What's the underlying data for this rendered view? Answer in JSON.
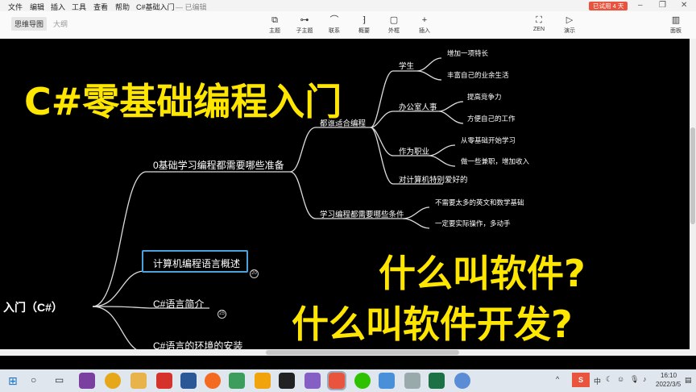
{
  "menubar": {
    "items": [
      "文件",
      "编辑",
      "插入",
      "工具",
      "查看",
      "帮助"
    ],
    "doc_title": "C#基础入门",
    "save_status": "— 已编辑",
    "trial_badge": "已试用 4 天"
  },
  "toolbar": {
    "view_tabs": [
      "思维导图",
      "大纲"
    ],
    "buttons": [
      "主题",
      "子主题",
      "联系",
      "概要",
      "外框",
      "插入"
    ],
    "right_buttons": [
      "ZEN",
      "演示",
      "面板"
    ]
  },
  "mindmap": {
    "root": "入门（C#）",
    "branches": {
      "b1": "0基础学习编程都需要哪些准备",
      "b2": "计算机编程语言概述",
      "b3": "C#语言简介",
      "b4": "C#语言的环境的安装"
    },
    "b1_children": {
      "suitable": "都谁适合编程",
      "conditions": "学习编程都需要哪些条件"
    },
    "suitable_children": [
      "学生",
      "办公室人事",
      "作为职业",
      "对计算机特别爱好的"
    ],
    "leaves": {
      "student": [
        "增加一项特长",
        "丰富自己的业余生活"
      ],
      "office": [
        "提高竞争力",
        "方便自己的工作"
      ],
      "career": [
        "从零基础开始学习",
        "做一些兼职，增加收入"
      ],
      "conditions": [
        "不需要太多的英文和数学基础",
        "一定要实际操作，多动手"
      ]
    },
    "badges": {
      "b2": "20",
      "b3": "25"
    }
  },
  "overlay": {
    "title": "C#零基础编程入门",
    "q1": "什么叫软件?",
    "q2": "什么叫软件开发?"
  },
  "taskbar": {
    "tray_ime": "中",
    "time": "16:10",
    "date": "2022/3/5"
  },
  "colors": {
    "highlight": "#ffe600",
    "selection": "#4aa3df",
    "trial": "#e8543e"
  }
}
